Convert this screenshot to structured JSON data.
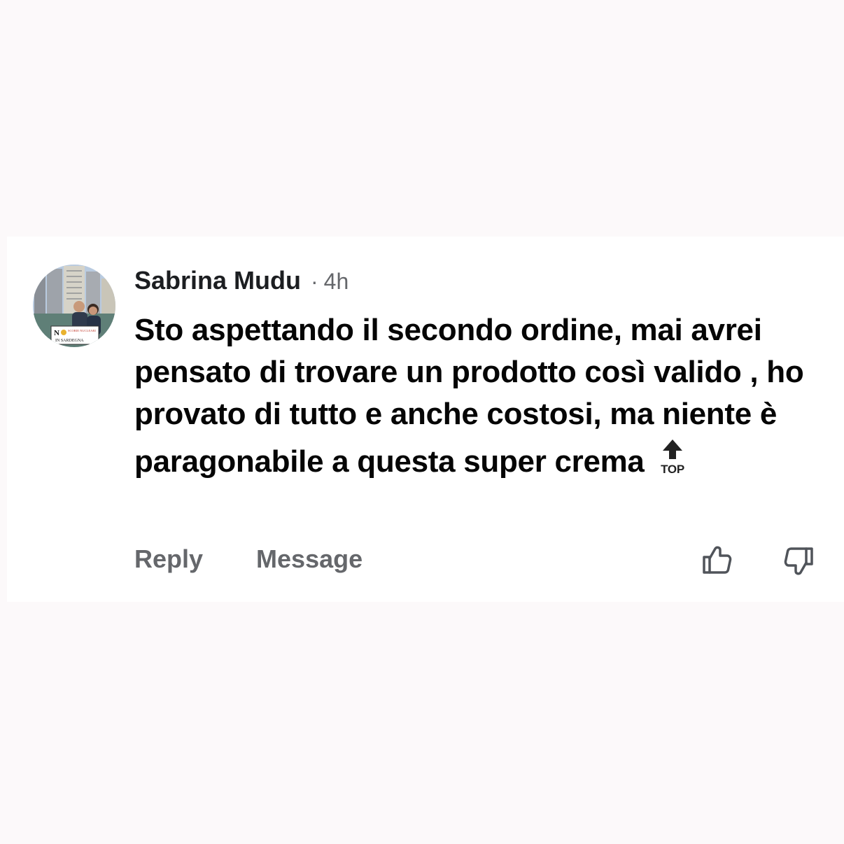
{
  "comment": {
    "author": "Sabrina Mudu",
    "separator": "·",
    "time": "4h",
    "text": "Sto aspettando il secondo ordine, mai avrei pensato di trovare un prodotto così valido , ho provato di tutto e anche costosi, ma niente è paragonabile a questa super crema",
    "emoji": {
      "icon": "top-arrow-emoji-icon",
      "label": "TOP"
    },
    "avatar_badge": {
      "line1": "N",
      "line2": "SCORIE NUCLEARI",
      "line3": "IN SARDEGNA"
    }
  },
  "actions": {
    "reply_label": "Reply",
    "message_label": "Message",
    "like_icon": "thumbs-up-icon",
    "dislike_icon": "thumbs-down-icon"
  },
  "colors": {
    "background": "#fcf9fa",
    "card": "#ffffff",
    "text_primary": "#050505",
    "text_secondary": "#65676b"
  }
}
